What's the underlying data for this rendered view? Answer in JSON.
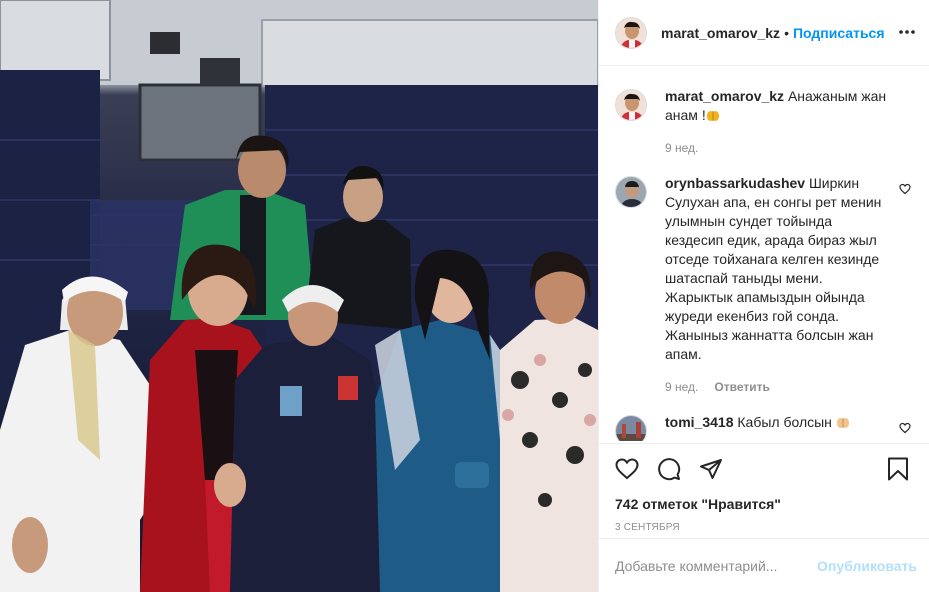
{
  "post": {
    "photo": {
      "icon": "group-photo"
    },
    "author": {
      "username": "marat_omarov_kz",
      "follow_label": "Подписаться",
      "separator": "•"
    },
    "more_icon": "more-horizontal-icon",
    "caption": {
      "username": "marat_omarov_kz",
      "text": "Анажаным жан анам !",
      "emoji_icon": "hands-emoji-icon",
      "time": "9 нед."
    },
    "comments": [
      {
        "username": "orynbassarkudashev",
        "text": "Ширкин Сулухан апа, ен сонгы рет менин улымнын сундет тойында кездесип едик, арада бираз жыл отседе тойханага келген кезинде шатаспай таныды мени. Жарыктык апамыздын ойында журеди екенбиз гой сонда. Жаныныз жаннатта болсын жан апам.",
        "time": "9 нед.",
        "reply_label": "Ответить"
      },
      {
        "username": "tomi_3418",
        "text": "Кабыл болсын",
        "emoji_icon": "hands-emoji-icon"
      }
    ],
    "actions": {
      "like_icon": "heart-icon",
      "comment_icon": "comment-icon",
      "share_icon": "share-icon",
      "save_icon": "bookmark-icon"
    },
    "likes": "742 отметок \"Нравится\"",
    "date": "3 сентября",
    "add_comment": {
      "placeholder": "Добавьте комментарий...",
      "publish_label": "Опубликовать"
    },
    "colors": {
      "accent": "#0095f6",
      "publish_disabled": "#b2dffc",
      "muted": "#8e8e8e",
      "border": "#efefef"
    }
  }
}
